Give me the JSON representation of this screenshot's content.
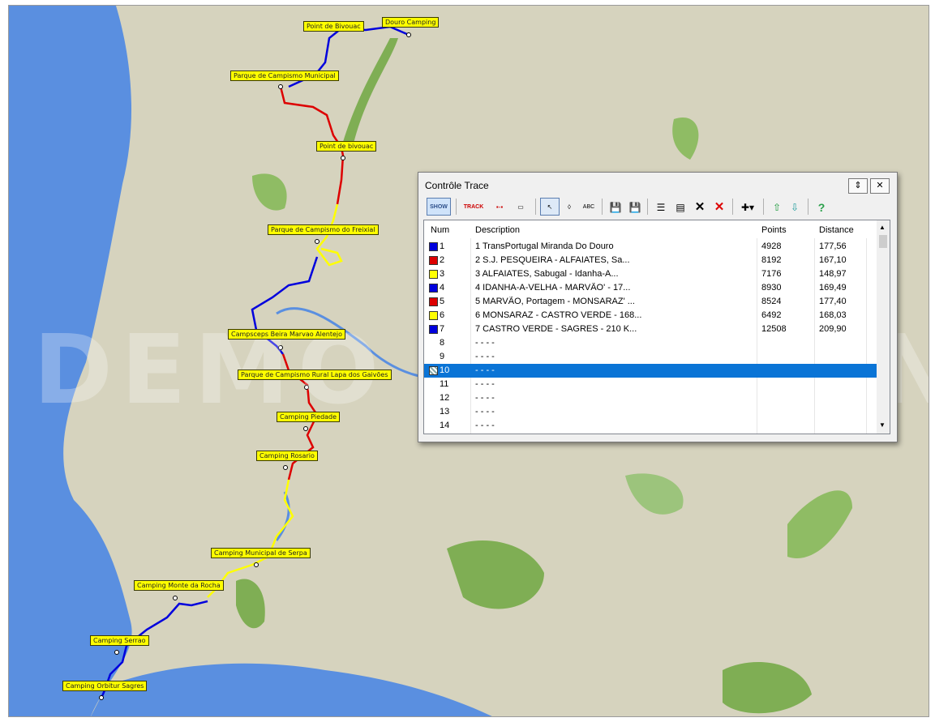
{
  "dialog": {
    "title": "Contrôle Trace",
    "toolbar": [
      "SHOW",
      "TRACK",
      "split",
      "ruler",
      "select",
      "point",
      "ABC",
      "save",
      "save-as",
      "list",
      "properties",
      "delete",
      "delete-red",
      "add",
      "up",
      "down",
      "help"
    ],
    "columns": {
      "num": "Num",
      "description": "Description",
      "points": "Points",
      "distance": "Distance"
    },
    "rows": [
      {
        "num": "1",
        "desc": "1 TransPortugal  Miranda Do Douro",
        "points": "4928",
        "dist": "177,56",
        "color": "#0000dd"
      },
      {
        "num": "2",
        "desc": "2 S.J. PESQUEIRA - ALFAIATES, Sa...",
        "points": "8192",
        "dist": "167,10",
        "color": "#dd0000"
      },
      {
        "num": "3",
        "desc": "3 ALFAIATES, Sabugal - Idanha-A...",
        "points": "7176",
        "dist": "148,97",
        "color": "#ffff00"
      },
      {
        "num": "4",
        "desc": "4 IDANHA-A-VELHA - MARVÃO' - 17...",
        "points": "8930",
        "dist": "169,49",
        "color": "#0000dd"
      },
      {
        "num": "5",
        "desc": "5 MARVÃO, Portagem - MONSARAZ' ...",
        "points": "8524",
        "dist": "177,40",
        "color": "#dd0000"
      },
      {
        "num": "6",
        "desc": "6 MONSARAZ - CASTRO VERDE - 168...",
        "points": "6492",
        "dist": "168,03",
        "color": "#ffff00"
      },
      {
        "num": "7",
        "desc": "7 CASTRO VERDE - SAGRES - 210 K...",
        "points": "12508",
        "dist": "209,90",
        "color": "#0000dd"
      },
      {
        "num": "8",
        "desc": "- - - -",
        "points": "",
        "dist": "",
        "color": ""
      },
      {
        "num": "9",
        "desc": "- - - -",
        "points": "",
        "dist": "",
        "color": ""
      },
      {
        "num": "10",
        "desc": "- - - -",
        "points": "",
        "dist": "",
        "color": "",
        "selected": true
      },
      {
        "num": "11",
        "desc": "- - - -",
        "points": "",
        "dist": "",
        "color": ""
      },
      {
        "num": "12",
        "desc": "- - - -",
        "points": "",
        "dist": "",
        "color": ""
      },
      {
        "num": "13",
        "desc": "- - - -",
        "points": "",
        "dist": "",
        "color": ""
      },
      {
        "num": "14",
        "desc": "- - - -",
        "points": "",
        "dist": "",
        "color": ""
      }
    ]
  },
  "map": {
    "watermark": "DEMO VERSION",
    "waypoints": [
      {
        "name": "Douro Camping"
      },
      {
        "name": "Point de Bivouac"
      },
      {
        "name": "Parque de Campismo Municipal"
      },
      {
        "name": "Point de bivouac"
      },
      {
        "name": "Parque de Campismo do Freixial"
      },
      {
        "name": "Campsceps Beira Marvao Alentejo"
      },
      {
        "name": "Parque de Campismo Rural Lapa dos Gaivões"
      },
      {
        "name": "Camping Piedade"
      },
      {
        "name": "Camping Rosario"
      },
      {
        "name": "Camping Municipal de Serpa"
      },
      {
        "name": "Camping Monte da Rocha"
      },
      {
        "name": "Camping Serrao"
      },
      {
        "name": "Camping Orbitur Sagres"
      }
    ]
  }
}
